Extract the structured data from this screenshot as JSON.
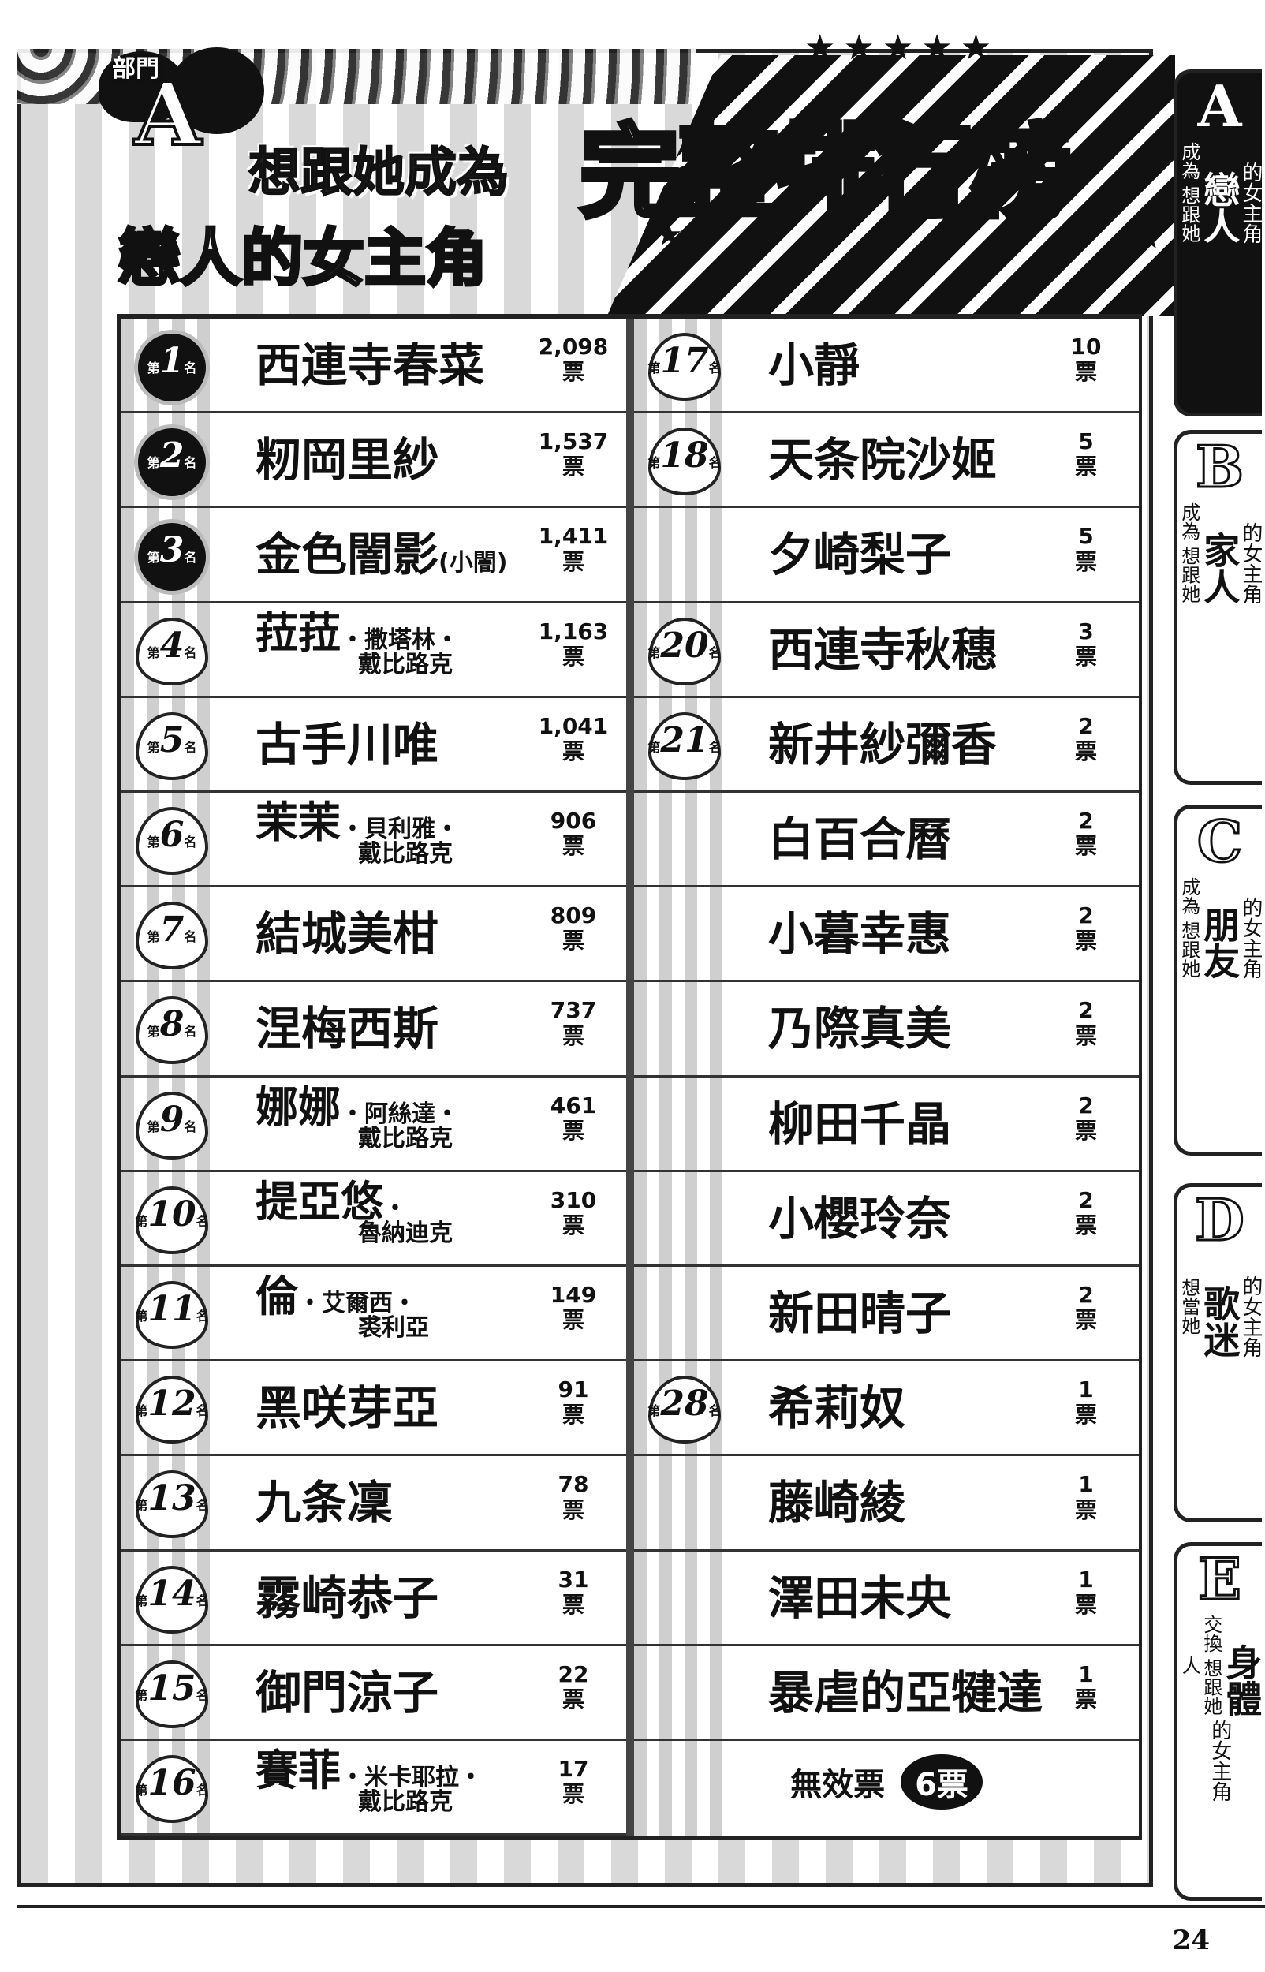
{
  "header": {
    "dept_label": "部門",
    "dept_letter": "A",
    "subtitle_line1": "想跟她成為",
    "subtitle_line2": "戀人的女主角",
    "title": "完整排行榜"
  },
  "left_column": [
    {
      "rank_prefix": "第",
      "rank": "1",
      "rank_suffix": "名",
      "name": "西連寺春菜",
      "sub": "",
      "line2": "",
      "votes": "2,098",
      "unit": "票"
    },
    {
      "rank_prefix": "第",
      "rank": "2",
      "rank_suffix": "名",
      "name": "籾岡里紗",
      "sub": "",
      "line2": "",
      "votes": "1,537",
      "unit": "票"
    },
    {
      "rank_prefix": "第",
      "rank": "3",
      "rank_suffix": "名",
      "name": "金色闇影",
      "sub": "(小闇)",
      "line2": "",
      "votes": "1,411",
      "unit": "票"
    },
    {
      "rank_prefix": "第",
      "rank": "4",
      "rank_suffix": "名",
      "name": "菈菈",
      "sub": "・撒塔林・",
      "line2": "戴比路克",
      "votes": "1,163",
      "unit": "票"
    },
    {
      "rank_prefix": "第",
      "rank": "5",
      "rank_suffix": "名",
      "name": "古手川唯",
      "sub": "",
      "line2": "",
      "votes": "1,041",
      "unit": "票"
    },
    {
      "rank_prefix": "第",
      "rank": "6",
      "rank_suffix": "名",
      "name": "茉茉",
      "sub": "・貝利雅・",
      "line2": "戴比路克",
      "votes": "906",
      "unit": "票"
    },
    {
      "rank_prefix": "第",
      "rank": "7",
      "rank_suffix": "名",
      "name": "結城美柑",
      "sub": "",
      "line2": "",
      "votes": "809",
      "unit": "票"
    },
    {
      "rank_prefix": "第",
      "rank": "8",
      "rank_suffix": "名",
      "name": "涅梅西斯",
      "sub": "",
      "line2": "",
      "votes": "737",
      "unit": "票"
    },
    {
      "rank_prefix": "第",
      "rank": "9",
      "rank_suffix": "名",
      "name": "娜娜",
      "sub": "・阿絲達・",
      "line2": "戴比路克",
      "votes": "461",
      "unit": "票"
    },
    {
      "rank_prefix": "第",
      "rank": "10",
      "rank_suffix": "名",
      "name": "提亞悠",
      "sub": "・",
      "line2": "魯納迪克",
      "votes": "310",
      "unit": "票"
    },
    {
      "rank_prefix": "第",
      "rank": "11",
      "rank_suffix": "名",
      "name": "倫",
      "sub": "・艾爾西・",
      "line2": "裘利亞",
      "votes": "149",
      "unit": "票"
    },
    {
      "rank_prefix": "第",
      "rank": "12",
      "rank_suffix": "名",
      "name": "黑咲芽亞",
      "sub": "",
      "line2": "",
      "votes": "91",
      "unit": "票"
    },
    {
      "rank_prefix": "第",
      "rank": "13",
      "rank_suffix": "名",
      "name": "九条凜",
      "sub": "",
      "line2": "",
      "votes": "78",
      "unit": "票"
    },
    {
      "rank_prefix": "第",
      "rank": "14",
      "rank_suffix": "名",
      "name": "霧崎恭子",
      "sub": "",
      "line2": "",
      "votes": "31",
      "unit": "票"
    },
    {
      "rank_prefix": "第",
      "rank": "15",
      "rank_suffix": "名",
      "name": "御門涼子",
      "sub": "",
      "line2": "",
      "votes": "22",
      "unit": "票"
    },
    {
      "rank_prefix": "第",
      "rank": "16",
      "rank_suffix": "名",
      "name": "賽菲",
      "sub": "・米卡耶拉・",
      "line2": "戴比路克",
      "votes": "17",
      "unit": "票"
    }
  ],
  "right_column": [
    {
      "rank_prefix": "第",
      "rank": "17",
      "rank_suffix": "名",
      "name": "小靜",
      "votes": "10",
      "unit": "票"
    },
    {
      "rank_prefix": "第",
      "rank": "18",
      "rank_suffix": "名",
      "name": "天条院沙姬",
      "votes": "5",
      "unit": "票"
    },
    {
      "rank_prefix": "",
      "rank": "",
      "rank_suffix": "",
      "name": "夕崎梨子",
      "votes": "5",
      "unit": "票"
    },
    {
      "rank_prefix": "第",
      "rank": "20",
      "rank_suffix": "名",
      "name": "西連寺秋穗",
      "votes": "3",
      "unit": "票"
    },
    {
      "rank_prefix": "第",
      "rank": "21",
      "rank_suffix": "名",
      "name": "新井紗彌香",
      "votes": "2",
      "unit": "票"
    },
    {
      "rank_prefix": "",
      "rank": "",
      "rank_suffix": "",
      "name": "白百合曆",
      "votes": "2",
      "unit": "票"
    },
    {
      "rank_prefix": "",
      "rank": "",
      "rank_suffix": "",
      "name": "小暮幸惠",
      "votes": "2",
      "unit": "票"
    },
    {
      "rank_prefix": "",
      "rank": "",
      "rank_suffix": "",
      "name": "乃際真美",
      "votes": "2",
      "unit": "票"
    },
    {
      "rank_prefix": "",
      "rank": "",
      "rank_suffix": "",
      "name": "柳田千晶",
      "votes": "2",
      "unit": "票"
    },
    {
      "rank_prefix": "",
      "rank": "",
      "rank_suffix": "",
      "name": "小櫻玲奈",
      "votes": "2",
      "unit": "票"
    },
    {
      "rank_prefix": "",
      "rank": "",
      "rank_suffix": "",
      "name": "新田晴子",
      "votes": "2",
      "unit": "票"
    },
    {
      "rank_prefix": "第",
      "rank": "28",
      "rank_suffix": "名",
      "name": "希莉奴",
      "votes": "1",
      "unit": "票"
    },
    {
      "rank_prefix": "",
      "rank": "",
      "rank_suffix": "",
      "name": "藤崎綾",
      "votes": "1",
      "unit": "票"
    },
    {
      "rank_prefix": "",
      "rank": "",
      "rank_suffix": "",
      "name": "澤田未央",
      "votes": "1",
      "unit": "票"
    },
    {
      "rank_prefix": "",
      "rank": "",
      "rank_suffix": "",
      "name": "暴虐的亞犍達",
      "votes": "1",
      "unit": "票"
    }
  ],
  "invalid": {
    "label": "無效票",
    "value": "6票"
  },
  "side_tabs": [
    {
      "letter": "A",
      "small": "成為 想跟她",
      "big": "戀人",
      "end": "的女主角",
      "active": true
    },
    {
      "letter": "B",
      "small": "成為 想跟她",
      "big": "家人",
      "end": "的女主角",
      "active": false
    },
    {
      "letter": "C",
      "small": "成為 想跟她",
      "big": "朋友",
      "end": "的女主角",
      "active": false
    },
    {
      "letter": "D",
      "small": "想當她",
      "big": "歌迷",
      "end": "的女主角",
      "active": false
    },
    {
      "letter": "E",
      "small": "交換 想跟她 人",
      "big": "身體",
      "end": "的女主角",
      "active": false
    }
  ],
  "page_number": "24"
}
